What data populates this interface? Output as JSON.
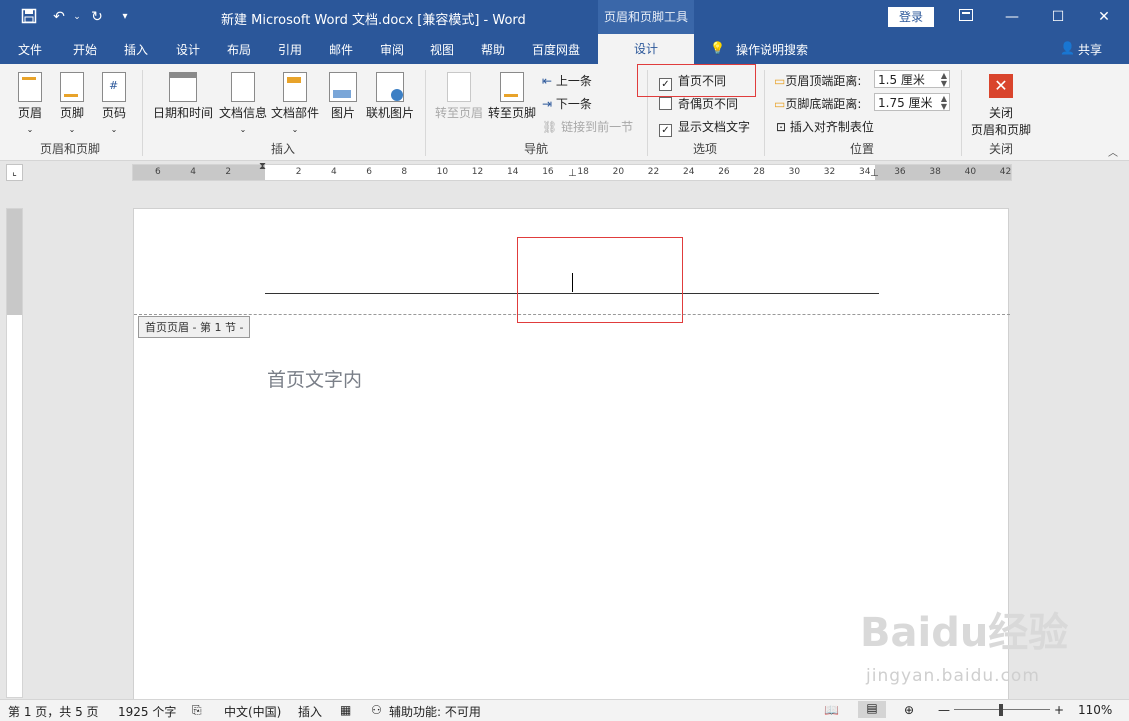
{
  "titlebar": {
    "doc_title": "新建 Microsoft Word 文档.docx [兼容模式]  -  Word",
    "context_group": "页眉和页脚工具",
    "login": "登录",
    "save_icon": "save-icon",
    "undo_icon": "undo-icon",
    "redo_icon": "redo-icon"
  },
  "tabs": {
    "file": "文件",
    "home": "开始",
    "insert": "插入",
    "design": "设计",
    "layout": "布局",
    "references": "引用",
    "mailings": "邮件",
    "review": "审阅",
    "view": "视图",
    "help": "帮助",
    "baidu": "百度网盘",
    "active": "设计",
    "search": "操作说明搜索",
    "share": "共享"
  },
  "ribbon": {
    "header": "页眉",
    "footer": "页脚",
    "page_number": "页码",
    "group_hf": "页眉和页脚",
    "date_time": "日期和时间",
    "doc_info": "文档信息",
    "doc_parts": "文档部件",
    "picture": "图片",
    "online_picture": "联机图片",
    "group_insert": "插入",
    "goto_header": "转至页眉",
    "goto_footer": "转至页脚",
    "prev": "上一条",
    "next": "下一条",
    "link_prev": "链接到前一节",
    "group_nav": "导航",
    "diff_first": "首页不同",
    "diff_odd_even": "奇偶页不同",
    "show_text": "显示文档文字",
    "group_options": "选项",
    "header_top_label": "页眉顶端距离:",
    "header_top_value": "1.5 厘米",
    "footer_bottom_label": "页脚底端距离:",
    "footer_bottom_value": "1.75 厘米",
    "insert_align_tab": "插入对齐制表位",
    "group_position": "位置",
    "close_line1": "关闭",
    "close_line2": "页眉和页脚",
    "group_close": "关闭"
  },
  "ruler": {
    "ticks": [
      "6",
      "4",
      "2",
      "",
      "2",
      "4",
      "6",
      "8",
      "10",
      "12",
      "14",
      "16",
      "18",
      "20",
      "22",
      "24",
      "26",
      "28",
      "30",
      "32",
      "34",
      "36",
      "38",
      "40",
      "42"
    ]
  },
  "document": {
    "header_tag": "首页页眉 - 第 1 节 -",
    "body_text": "首页文字内"
  },
  "statusbar": {
    "page": "第 1 页，共 5 页",
    "words": "1925 个字",
    "language": "中文(中国)",
    "mode": "插入",
    "accessibility": "辅助功能: 不可用",
    "zoom": "110%"
  },
  "watermark": {
    "brand": "Baidu经验",
    "url": "jingyan.baidu.com"
  }
}
